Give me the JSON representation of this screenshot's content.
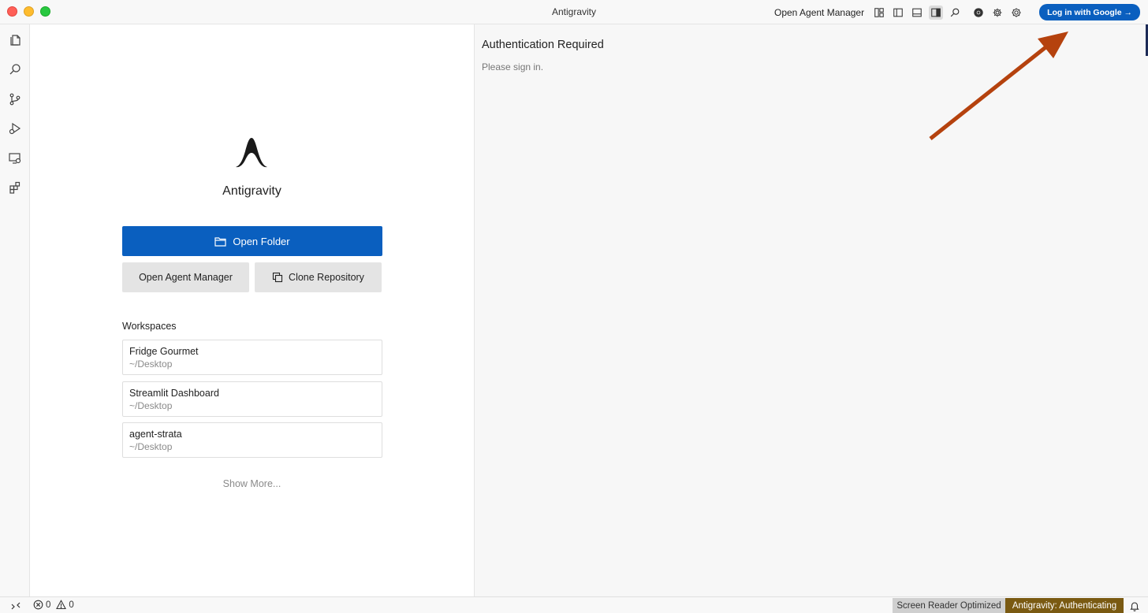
{
  "window": {
    "title": "Antigravity"
  },
  "titlebar": {
    "open_agent_manager": "Open Agent Manager",
    "login_button": "Log in with Google →",
    "icons": [
      "customize-layout-icon",
      "toggle-primary-sidebar-icon",
      "toggle-panel-icon",
      "toggle-secondary-sidebar-icon",
      "search-icon",
      "chrome-icon",
      "settings-gear-icon",
      "account-settings-icon"
    ]
  },
  "activity_bar": {
    "icons": [
      "explorer-icon",
      "search-icon",
      "source-control-icon",
      "run-debug-icon",
      "remote-explorer-icon",
      "extensions-icon"
    ]
  },
  "welcome": {
    "app_name": "Antigravity",
    "open_folder": "Open Folder",
    "open_agent_manager": "Open Agent Manager",
    "clone_repository": "Clone Repository",
    "workspaces_heading": "Workspaces",
    "workspaces": [
      {
        "name": "Fridge Gourmet",
        "path": "~/Desktop"
      },
      {
        "name": "Streamlit Dashboard",
        "path": "~/Desktop"
      },
      {
        "name": "agent-strata",
        "path": "~/Desktop"
      }
    ],
    "show_more": "Show More..."
  },
  "auth_panel": {
    "title": "Authentication Required",
    "subtitle": "Please sign in."
  },
  "statusbar": {
    "errors": "0",
    "warnings": "0",
    "screen_reader": "Screen Reader Optimized",
    "antigravity_status": "Antigravity: Authenticating"
  },
  "colors": {
    "primary_button": "#0a5fbf",
    "status_antigravity_bg": "#7a5a12",
    "annotation_arrow": "#b5420e"
  }
}
